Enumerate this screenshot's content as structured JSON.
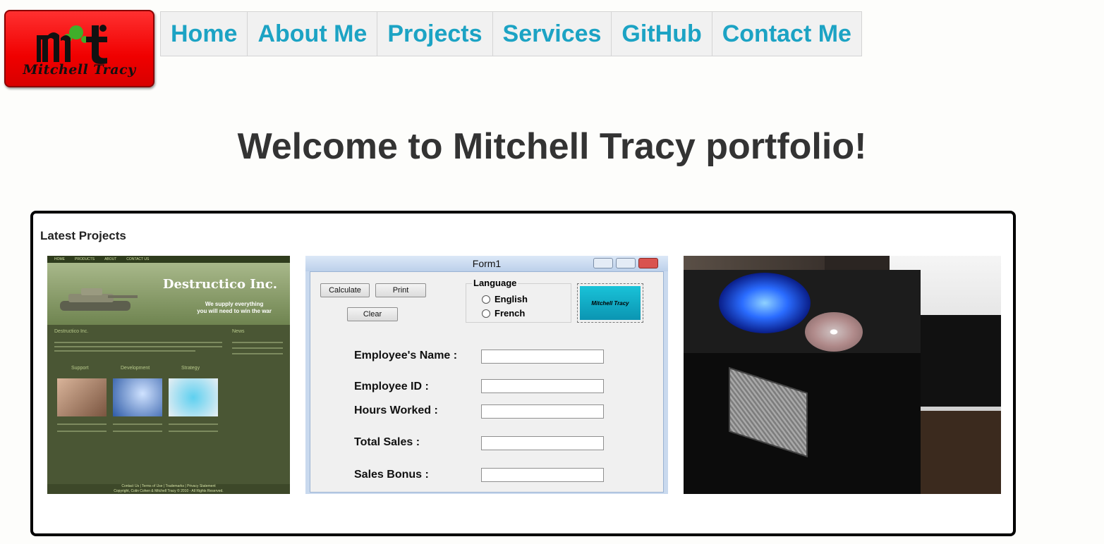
{
  "logo": {
    "text": "Mitchell Tracy"
  },
  "nav": {
    "items": [
      "Home",
      "About Me",
      "Projects",
      "Services",
      "GitHub",
      "Contact Me"
    ]
  },
  "welcome": {
    "heading": "Welcome to Mitchell Tracy portfolio!"
  },
  "projects": {
    "title": "Latest Projects",
    "thumb1": {
      "nav": [
        "HOME",
        "PRODUCTS",
        "ABOUT",
        "CONTACT US"
      ],
      "site_title": "Destructico Inc.",
      "tagline_1": "We supply everything",
      "tagline_2": "you will need to win the war",
      "section_title": "Destructico Inc.",
      "news": "News",
      "col_support": "Support",
      "col_development": "Development",
      "col_strategy": "Strategy",
      "footer_links": "Contact Us | Terms of Use | Trademarks | Privacy Statement",
      "footer_copy": "Copyright, Colin Cohen & Mitchell Tracy © 2010 - All Rights Reserved."
    },
    "thumb2": {
      "window_title": "Form1",
      "btn_calculate": "Calculate",
      "btn_print": "Print",
      "btn_clear": "Clear",
      "group_language": "Language",
      "radio_english": "English",
      "radio_french": "French",
      "logo_text": "Mitchell Tracy",
      "label_name": "Employee's Name :",
      "label_id": "Employee ID :",
      "label_hours": "Hours Worked :",
      "label_sales": "Total Sales :",
      "label_bonus": "Sales Bonus :"
    }
  },
  "colors": {
    "nav_text": "#1ca3c4",
    "logo_red": "#f00000",
    "heading": "#333333"
  }
}
